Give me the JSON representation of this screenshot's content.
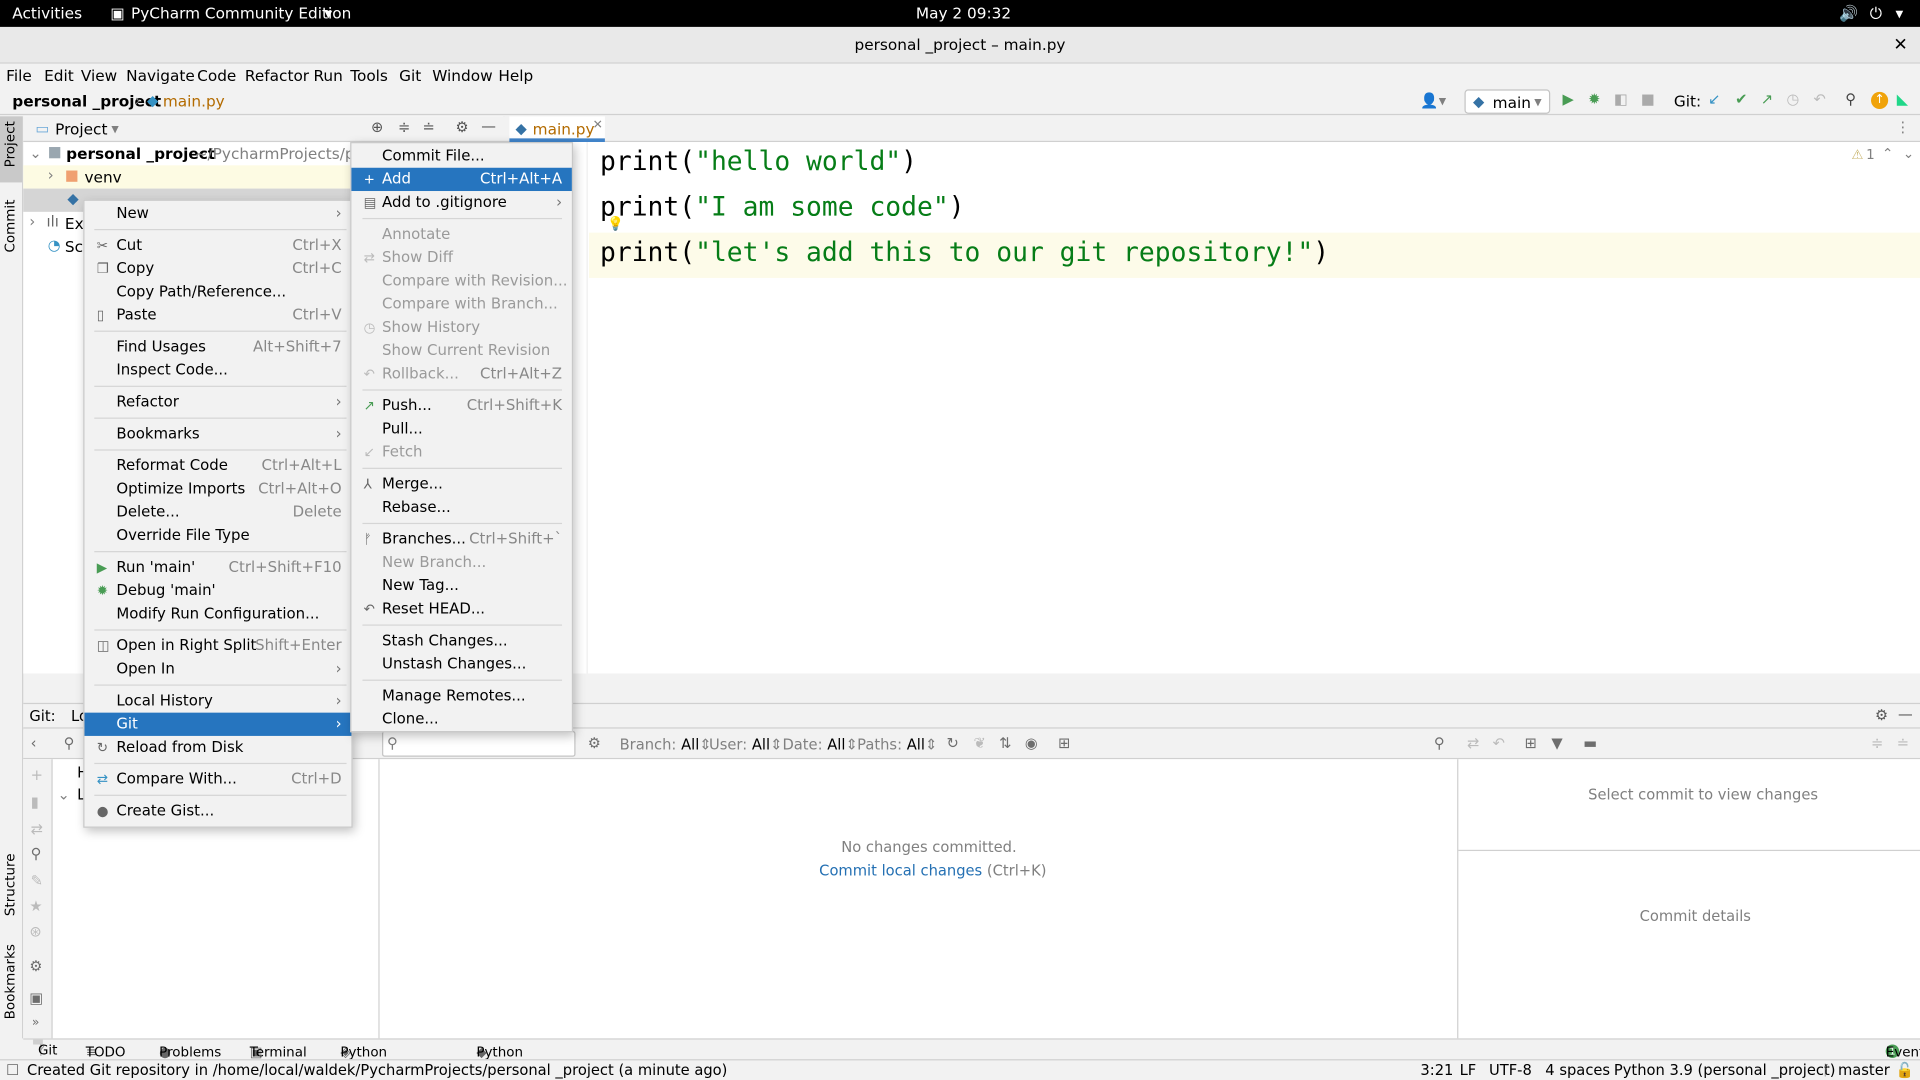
{
  "system_bar": {
    "activities": "Activities",
    "app_name": "PyCharm Community Edition",
    "clock": "May 2  09:32"
  },
  "window": {
    "title": "personal _project – main.py"
  },
  "menubar": [
    "File",
    "Edit",
    "View",
    "Navigate",
    "Code",
    "Refactor",
    "Run",
    "Tools",
    "Git",
    "Window",
    "Help"
  ],
  "breadcrumb": {
    "project": "personal _project",
    "file": "main.py"
  },
  "toolbar": {
    "run_config": "main",
    "git_label": "Git:"
  },
  "project_panel": {
    "title": "Project",
    "root_name": "personal _project",
    "root_path": "~/PycharmProjects/pers",
    "items": [
      "venv",
      "Ex",
      "Sc"
    ]
  },
  "editor": {
    "tab": "main.py",
    "warnings": "1",
    "lines": [
      {
        "fn": "print(",
        "str": "\"hello world\"",
        "end": ")"
      },
      {
        "fn": "print(",
        "str": "\"I am some code\"",
        "end": ")"
      },
      {
        "fn": "print(",
        "str": "\"let's add this to our git repository!\"",
        "end": ")"
      }
    ]
  },
  "context_menu": [
    {
      "label": "New",
      "submenu": true
    },
    {
      "sep": true
    },
    {
      "label": "Cut",
      "shortcut": "Ctrl+X",
      "icon": "✂"
    },
    {
      "label": "Copy",
      "shortcut": "Ctrl+C",
      "icon": "❐"
    },
    {
      "label": "Copy Path/Reference..."
    },
    {
      "label": "Paste",
      "shortcut": "Ctrl+V",
      "icon": "▯"
    },
    {
      "sep": true
    },
    {
      "label": "Find Usages",
      "shortcut": "Alt+Shift+7"
    },
    {
      "label": "Inspect Code..."
    },
    {
      "sep": true
    },
    {
      "label": "Refactor",
      "submenu": true
    },
    {
      "sep": true
    },
    {
      "label": "Bookmarks",
      "submenu": true
    },
    {
      "sep": true
    },
    {
      "label": "Reformat Code",
      "shortcut": "Ctrl+Alt+L"
    },
    {
      "label": "Optimize Imports",
      "shortcut": "Ctrl+Alt+O"
    },
    {
      "label": "Delete...",
      "shortcut": "Delete"
    },
    {
      "label": "Override File Type"
    },
    {
      "sep": true
    },
    {
      "label": "Run 'main'",
      "shortcut": "Ctrl+Shift+F10",
      "icon": "▶",
      "icon_color": "#499c54"
    },
    {
      "label": "Debug 'main'",
      "icon": "✹",
      "icon_color": "#499c54"
    },
    {
      "label": "Modify Run Configuration..."
    },
    {
      "sep": true
    },
    {
      "label": "Open in Right Split",
      "shortcut": "Shift+Enter",
      "icon": "◫"
    },
    {
      "label": "Open In",
      "submenu": true
    },
    {
      "sep": true
    },
    {
      "label": "Local History",
      "submenu": true
    },
    {
      "label": "Git",
      "submenu": true,
      "selected": true
    },
    {
      "label": "Reload from Disk",
      "icon": "↻"
    },
    {
      "sep": true
    },
    {
      "label": "Compare With...",
      "shortcut": "Ctrl+D",
      "icon": "⇄",
      "icon_color": "#3592c4"
    },
    {
      "sep": true
    },
    {
      "label": "Create Gist...",
      "icon": "●"
    }
  ],
  "git_submenu": [
    {
      "label": "Commit File..."
    },
    {
      "label": "Add",
      "shortcut": "Ctrl+Alt+A",
      "icon": "+",
      "selected": true
    },
    {
      "label": "Add to .gitignore",
      "submenu": true,
      "icon": "▤"
    },
    {
      "sep": true
    },
    {
      "label": "Annotate",
      "disabled": true
    },
    {
      "label": "Show Diff",
      "disabled": true,
      "icon": "⇄"
    },
    {
      "label": "Compare with Revision...",
      "disabled": true
    },
    {
      "label": "Compare with Branch...",
      "disabled": true
    },
    {
      "label": "Show History",
      "disabled": true,
      "icon": "◷"
    },
    {
      "label": "Show Current Revision",
      "disabled": true
    },
    {
      "label": "Rollback...",
      "shortcut": "Ctrl+Alt+Z",
      "disabled": true,
      "icon": "↶"
    },
    {
      "sep": true
    },
    {
      "label": "Push...",
      "shortcut": "Ctrl+Shift+K",
      "icon": "↗",
      "icon_color": "#499c54"
    },
    {
      "label": "Pull..."
    },
    {
      "label": "Fetch",
      "disabled": true,
      "icon": "↙"
    },
    {
      "sep": true
    },
    {
      "label": "Merge...",
      "icon": "⅄"
    },
    {
      "label": "Rebase..."
    },
    {
      "sep": true
    },
    {
      "label": "Branches...",
      "shortcut": "Ctrl+Shift+`",
      "icon": "ᚠ"
    },
    {
      "label": "New Branch...",
      "disabled": true
    },
    {
      "label": "New Tag..."
    },
    {
      "label": "Reset HEAD...",
      "icon": "↶"
    },
    {
      "sep": true
    },
    {
      "label": "Stash Changes..."
    },
    {
      "label": "Unstash Changes..."
    },
    {
      "sep": true
    },
    {
      "label": "Manage Remotes..."
    },
    {
      "label": "Clone..."
    }
  ],
  "git_panel": {
    "label": "Git:",
    "tab": "Lo",
    "tree": [
      "H",
      "L"
    ],
    "filters": {
      "branch": "Branch:",
      "branch_val": "All",
      "user": "User:",
      "user_val": "All",
      "date": "Date:",
      "date_val": "All",
      "paths": "Paths:",
      "paths_val": "All"
    },
    "empty": "No changes committed.",
    "commit_link": "Commit local changes",
    "commit_shortcut": "(Ctrl+K)",
    "select_commit": "Select commit to view changes",
    "commit_details": "Commit details"
  },
  "bottom_tools": [
    "Git",
    "TODO",
    "Problems",
    "Terminal",
    "Python Packages",
    "Python Console"
  ],
  "event_log": {
    "count": "1",
    "label": "Event Log"
  },
  "status_bar": {
    "message": "Created Git repository in /home/local/waldek/PycharmProjects/personal _project (a minute ago)",
    "position": "3:21",
    "line_sep": "LF",
    "encoding": "UTF-8",
    "indent": "4 spaces",
    "interpreter": "Python 3.9 (personal _project)",
    "branch": "master"
  },
  "side_labels": {
    "project": "Project",
    "commit": "Commit",
    "structure": "Structure",
    "bookmarks": "Bookmarks"
  },
  "colors": {
    "selection": "#2675bf",
    "string": "#067d17",
    "link": "#2470b3"
  }
}
